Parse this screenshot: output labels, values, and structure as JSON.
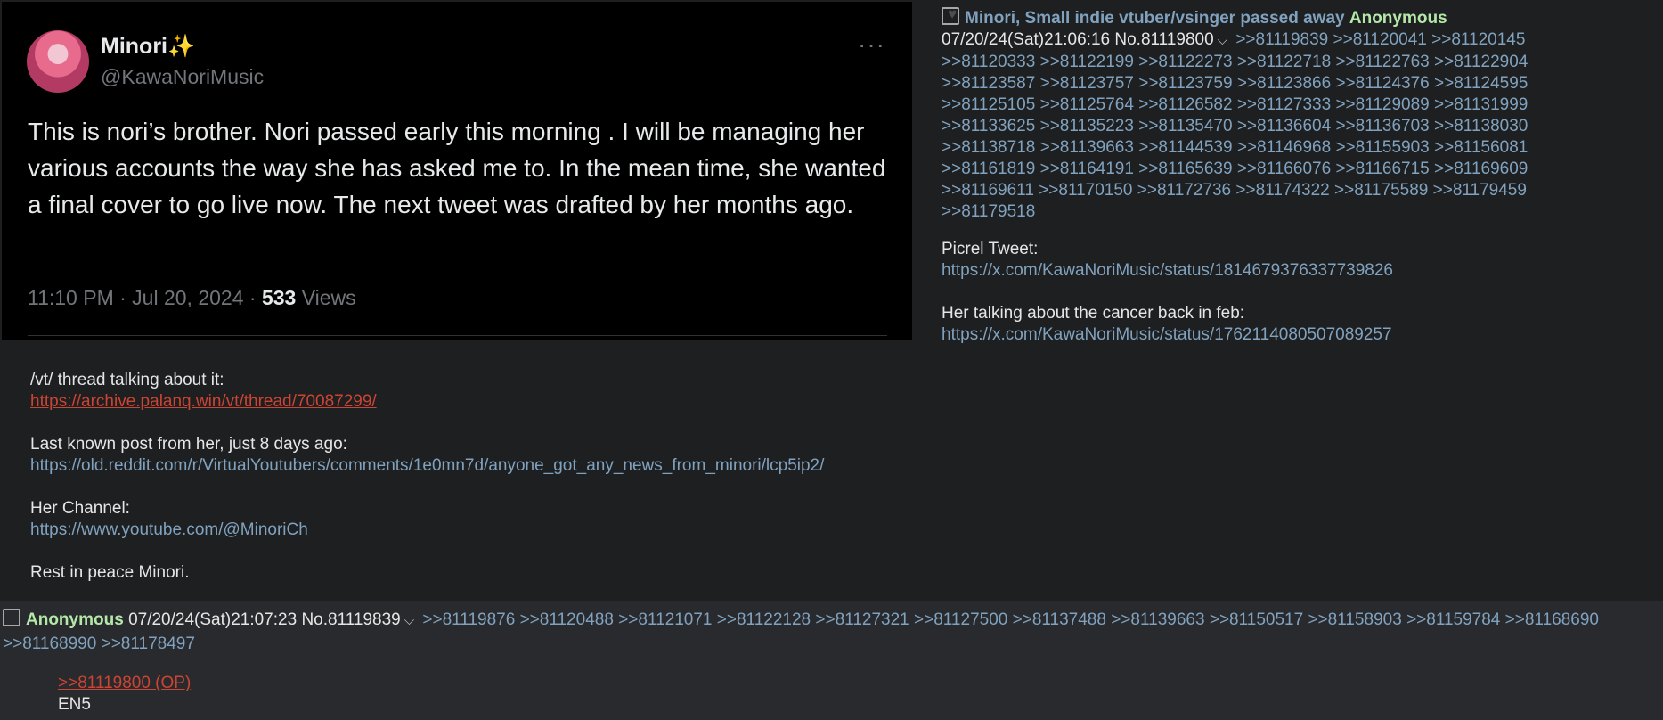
{
  "tweet": {
    "name": "Minori✨",
    "handle": "@KawaNoriMusic",
    "more": "···",
    "text": "This is nori’s brother. Nori passed early this morning . I will be managing her various accounts the way she has asked me to. In the mean time, she wanted a final cover to go live now. The next tweet was drafted by her months ago.",
    "time": "11:10 PM · Jul 20, 2024 · ",
    "views_count": "533",
    "views_label": "Views"
  },
  "op": {
    "subject": "Minori, Small indie vtuber/vsinger passed away",
    "name": "Anonymous",
    "date": "07/20/24(Sat)21:06:16",
    "number": "No.81119800",
    "replies": [
      ">>81119839",
      ">>81120041",
      ">>81120145",
      ">>81120333",
      ">>81122199",
      ">>81122273",
      ">>81122718",
      ">>81122763",
      ">>81122904",
      ">>81123587",
      ">>81123757",
      ">>81123759",
      ">>81123866",
      ">>81124376",
      ">>81124595",
      ">>81125105",
      ">>81125764",
      ">>81126582",
      ">>81127333",
      ">>81129089",
      ">>81131999",
      ">>81133625",
      ">>81135223",
      ">>81135470",
      ">>81136604",
      ">>81136703",
      ">>81138030",
      ">>81138718",
      ">>81139663",
      ">>81144539",
      ">>81146968",
      ">>81155903",
      ">>81156081",
      ">>81161819",
      ">>81164191",
      ">>81165639",
      ">>81166076",
      ">>81166715",
      ">>81169609",
      ">>81169611",
      ">>81170150",
      ">>81172736",
      ">>81174322",
      ">>81175589",
      ">>81179459",
      ">>81179518"
    ],
    "picrel_label": "Picrel Tweet:",
    "picrel_link": "https://x.com/KawaNoriMusic/status/1814679376337739826",
    "cancer_label": "Her talking about the cancer back in feb:",
    "cancer_link": "https://x.com/KawaNoriMusic/status/1762114080507089257",
    "vt_label": "/vt/ thread talking about it:",
    "vt_link": "https://archive.palanq.win/vt/thread/70087299/",
    "last_label": "Last known post from her, just 8 days ago:",
    "last_link": "https://old.reddit.com/r/VirtualYoutubers/comments/1e0mn7d/anyone_got_any_news_from_minori/lcp5ip2/",
    "channel_label": "Her Channel:",
    "channel_link": "https://www.youtube.com/@MinoriCh",
    "closing": "Rest in peace Minori."
  },
  "reply": {
    "name": "Anonymous",
    "date": "07/20/24(Sat)21:07:23",
    "number": "No.81119839",
    "replies": [
      ">>81119876",
      ">>81120488",
      ">>81121071",
      ">>81122128",
      ">>81127321",
      ">>81127500",
      ">>81137488",
      ">>81139663",
      ">>81150517",
      ">>81158903",
      ">>81159784",
      ">>81168690",
      ">>81168990",
      ">>81178497"
    ],
    "quote": ">>81119800 (OP)",
    "text": "EN5"
  },
  "colors": {
    "subject": "#81a2be",
    "name": "#b5e8a8",
    "link_red": "#cc4433",
    "background": "#1d1f21",
    "reply_background": "#282a2e"
  },
  "icons": [
    "heart-icon",
    "checkbox-icon",
    "chevron-down-icon",
    "avatar"
  ]
}
